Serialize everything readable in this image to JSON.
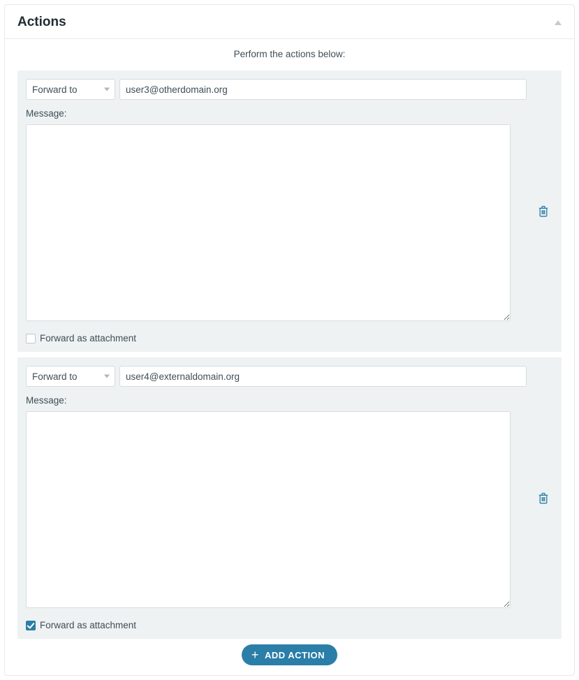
{
  "panel": {
    "title": "Actions",
    "instruction": "Perform the actions below:"
  },
  "actions": [
    {
      "type_label": "Forward to",
      "target": "user3@otherdomain.org",
      "message_label": "Message:",
      "message_value": "",
      "attachment_label": "Forward as attachment",
      "attachment_checked": false
    },
    {
      "type_label": "Forward to",
      "target": "user4@externaldomain.org",
      "message_label": "Message:",
      "message_value": "",
      "attachment_label": "Forward as attachment",
      "attachment_checked": true
    }
  ],
  "buttons": {
    "add_action": "ADD ACTION"
  }
}
